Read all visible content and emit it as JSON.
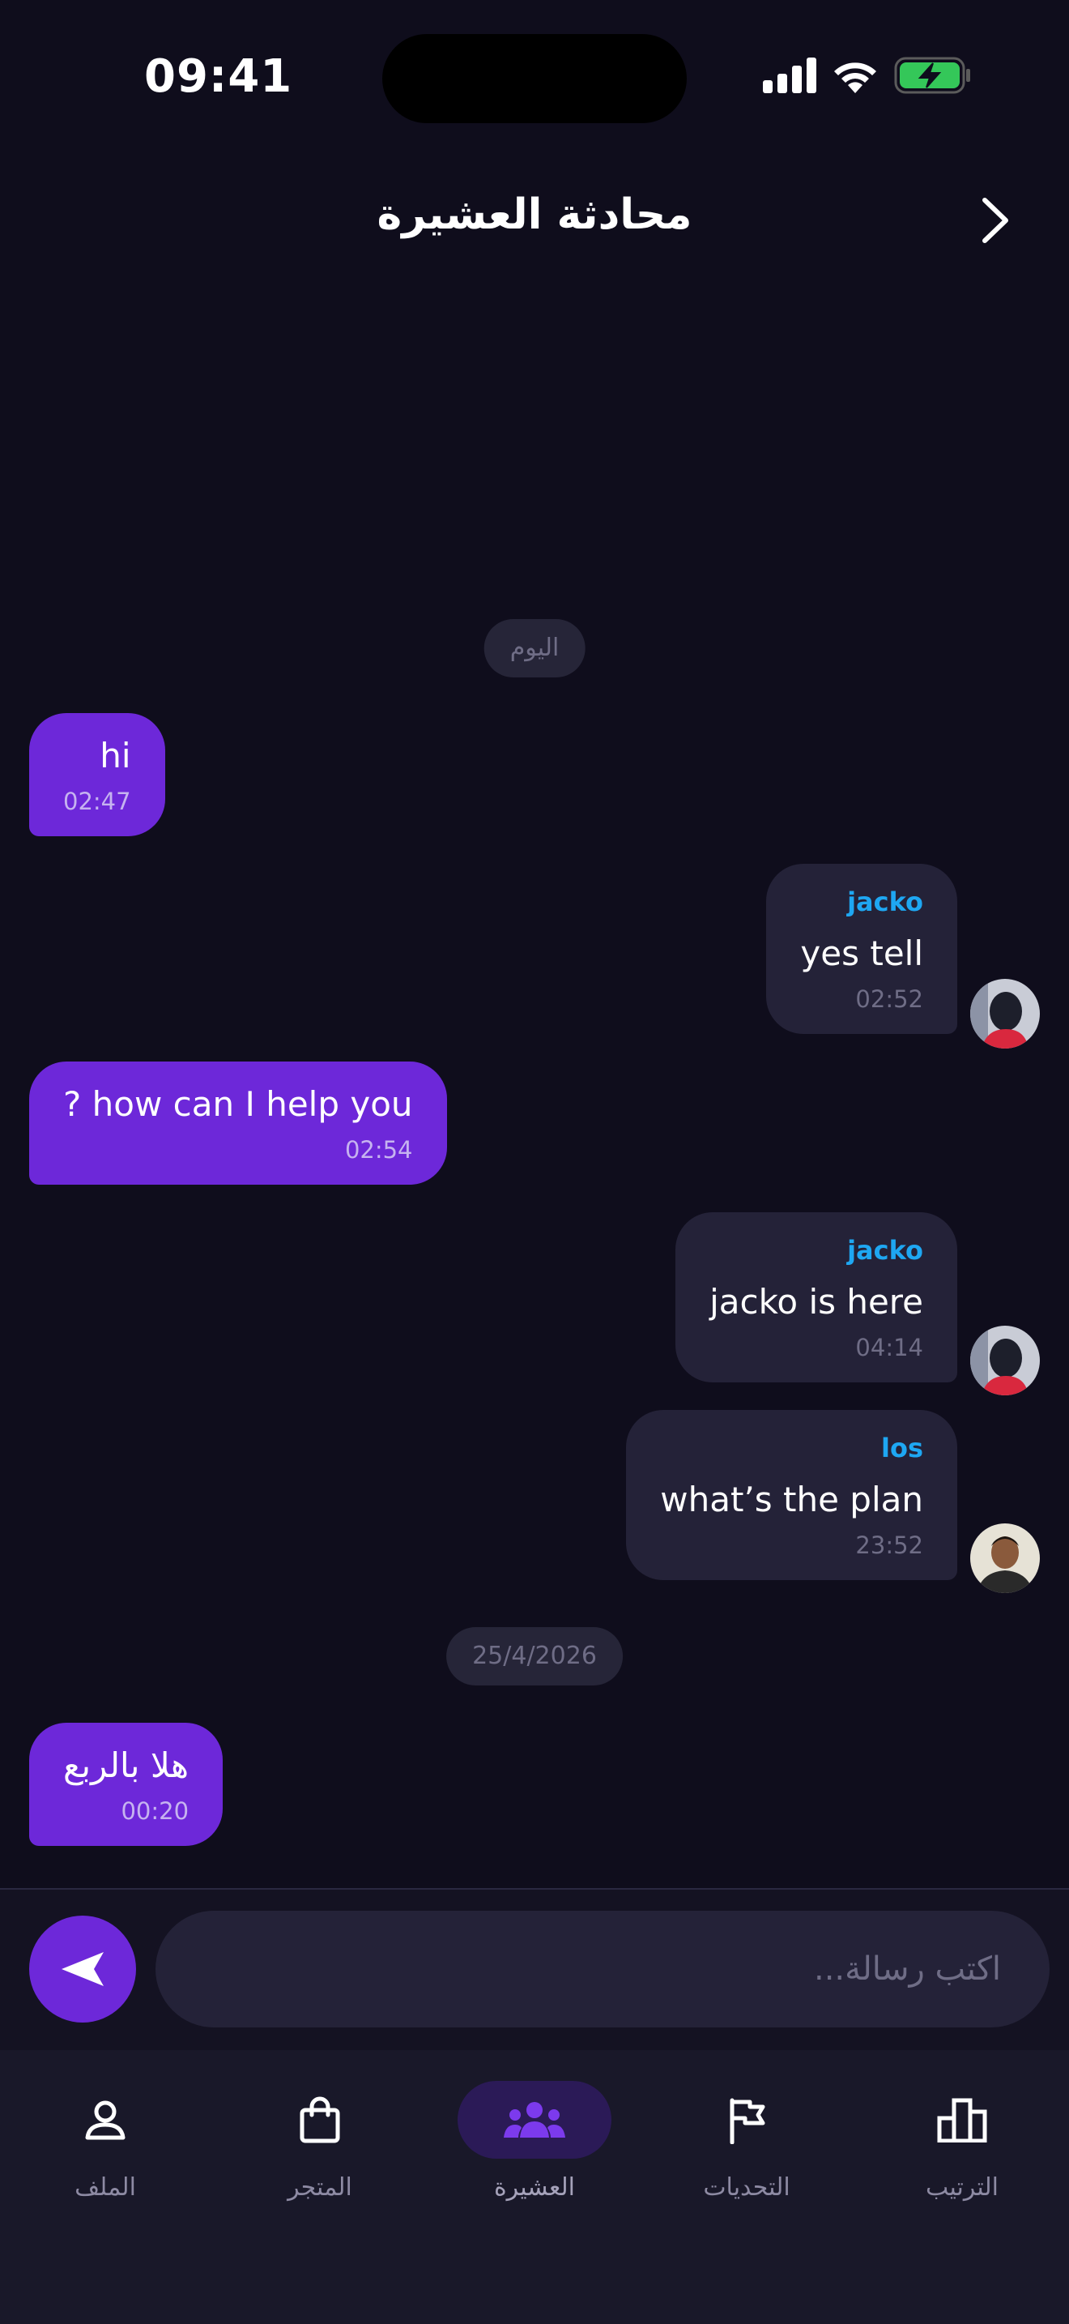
{
  "status_bar": {
    "time": "09:41"
  },
  "header": {
    "title": "محادثة العشيرة"
  },
  "messages": [
    {
      "date_label": "اليوم"
    },
    {
      "text": "hi",
      "time": "02:47"
    },
    {
      "sender": "jacko",
      "text": "yes tell",
      "time": "02:52"
    },
    {
      "text": "? how can I help you",
      "time": "02:54"
    },
    {
      "sender": "jacko",
      "text": "jacko is here",
      "time": "04:14"
    },
    {
      "sender": "los",
      "text": "what’s the plan",
      "time": "23:52"
    },
    {
      "date_label": "25/4/2026"
    },
    {
      "text": "هلا بالربع",
      "time": "00:20"
    }
  ],
  "composer": {
    "placeholder": "اكتب رسالة..."
  },
  "nav": {
    "items": [
      {
        "label": "الملف",
        "icon": "user-icon"
      },
      {
        "label": "المتجر",
        "icon": "shopping-bag-icon"
      },
      {
        "label": "العشيرة",
        "icon": "group-icon",
        "active": true
      },
      {
        "label": "التحديات",
        "icon": "flag-icon"
      },
      {
        "label": "الترتيب",
        "icon": "leaderboard-icon"
      }
    ]
  },
  "colors": {
    "background": "#0f0d1c",
    "accent": "#6d28d9",
    "bubble_other": "#242238",
    "sender_name": "#1ea7f2",
    "battery": "#34c759"
  }
}
